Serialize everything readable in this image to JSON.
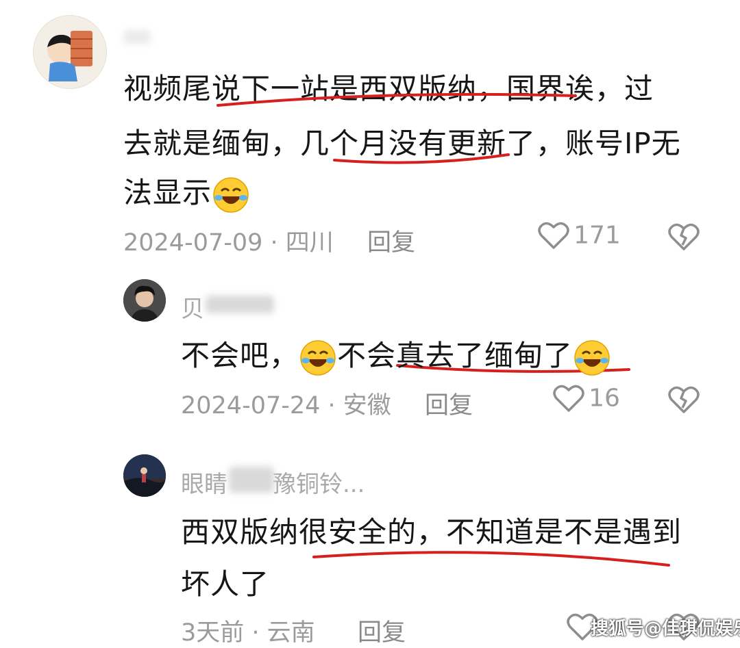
{
  "comments": [
    {
      "username": "",
      "lines": [
        "视频尾说下一站是西双版纳，国界诶，过",
        "去就是缅甸，几个月没有更新了，账号IP无",
        "法显示"
      ],
      "date_location": "2024-07-09 · 四川",
      "reply_label": "回复",
      "like_count": "171"
    },
    {
      "username": "贝",
      "lines": [
        "不会吧，",
        "不会真去了缅甸了"
      ],
      "date_location": "2024-07-24 · 安徽",
      "reply_label": "回复",
      "like_count": "16"
    },
    {
      "username_prefix": "眼睛",
      "username_suffix": "豫铜铃...",
      "lines": [
        "西双版纳很安全的，不知道是不是遇到",
        "坏人了"
      ],
      "date_location": "3天前 · 云南",
      "reply_label": "回复"
    }
  ],
  "watermark": "搜狐号@佳琪侃娱乐",
  "icons": {
    "like": "heart-outline-icon",
    "dislike": "broken-heart-icon",
    "emoji": "rofl-emoji-icon"
  },
  "colors": {
    "underline": "#d62020",
    "meta": "#9b9b9b"
  }
}
